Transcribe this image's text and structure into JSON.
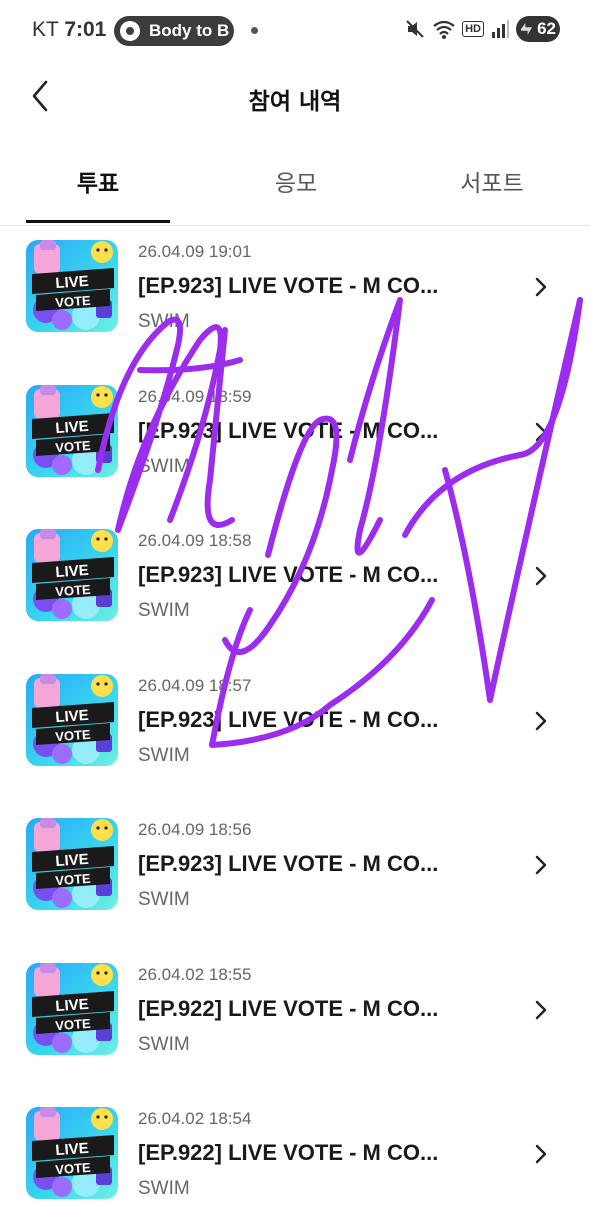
{
  "status_bar": {
    "carrier": "KT",
    "time": "7:01",
    "notification_pill": "Body to B",
    "hd_label": "HD",
    "battery": "62"
  },
  "header": {
    "title": "참여 내역"
  },
  "tabs": [
    {
      "label": "투표",
      "active": true
    },
    {
      "label": "응모",
      "active": false
    },
    {
      "label": "서포트",
      "active": false
    }
  ],
  "thumbnail_text": {
    "line1": "LIVE",
    "line2": "VOTE"
  },
  "items": [
    {
      "date": "26.04.09 19:01",
      "title": "[EP.923] LIVE VOTE - M CO...",
      "subtitle": "SWIM"
    },
    {
      "date": "26.04.09 18:59",
      "title": "[EP.923] LIVE VOTE - M CO...",
      "subtitle": "SWIM"
    },
    {
      "date": "26.04.09 18:58",
      "title": "[EP.923] LIVE VOTE - M CO...",
      "subtitle": "SWIM"
    },
    {
      "date": "26.04.09 18:57",
      "title": "[EP.923] LIVE VOTE - M CO...",
      "subtitle": "SWIM"
    },
    {
      "date": "26.04.09 18:56",
      "title": "[EP.923] LIVE VOTE - M CO...",
      "subtitle": "SWIM"
    },
    {
      "date": "26.04.02 18:55",
      "title": "[EP.922] LIVE VOTE - M CO...",
      "subtitle": "SWIM"
    },
    {
      "date": "26.04.02 18:54",
      "title": "[EP.922] LIVE VOTE - M CO...",
      "subtitle": "SWIM"
    }
  ],
  "colors": {
    "signature": "#9b2cf0",
    "thumb_bg": "#3ad0f2",
    "thumb_banner": "#1a1a1a",
    "thumb_text": "#ffffff"
  }
}
